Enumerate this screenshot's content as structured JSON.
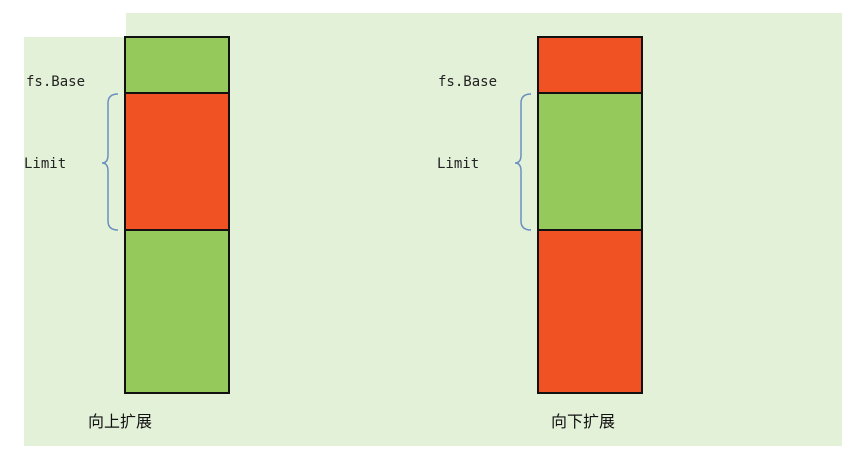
{
  "colors": {
    "green": "#95c95c",
    "orange": "#f05224",
    "background": "#e4f1d9",
    "brace": "#6b8fbf",
    "border": "#111111"
  },
  "diagrams": [
    {
      "caption": "向上扩展",
      "base_label": "fs.Base",
      "limit_label": "Limit",
      "segments": [
        {
          "color": "green"
        },
        {
          "color": "orange"
        },
        {
          "color": "green"
        }
      ]
    },
    {
      "caption": "向下扩展",
      "base_label": "fs.Base",
      "limit_label": "Limit",
      "segments": [
        {
          "color": "orange"
        },
        {
          "color": "green"
        },
        {
          "color": "orange"
        }
      ]
    }
  ]
}
